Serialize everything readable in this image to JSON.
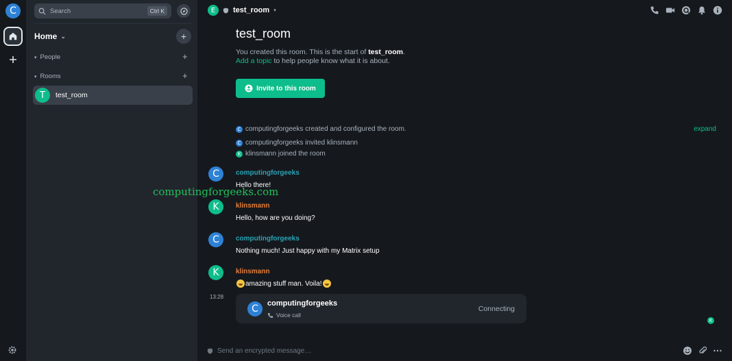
{
  "user": {
    "avatar_letter": "C"
  },
  "space_panel": {
    "home_icon": "home-icon",
    "add_space_icon": "plus-icon",
    "settings_icon": "gear-icon"
  },
  "search": {
    "placeholder": "Search",
    "shortcut": "Ctrl K"
  },
  "home": {
    "title": "Home"
  },
  "sections": {
    "people": {
      "label": "People"
    },
    "rooms": {
      "label": "Rooms"
    }
  },
  "rooms": [
    {
      "avatar_letter": "T",
      "name": "test_room"
    }
  ],
  "header": {
    "avatar_letter": "E",
    "title": "test_room"
  },
  "intro": {
    "title": "test_room",
    "line1_prefix": "You created this room. This is the start of ",
    "line1_room": "test_room",
    "line1_suffix": ".",
    "topic_link": "Add a topic",
    "line2_suffix": " to help people know what it is about.",
    "invite_label": "Invite to this room"
  },
  "events": [
    {
      "avatar_letter": "C",
      "color": "#2e82d6",
      "text": "computingforgeeks created and configured the room."
    },
    {
      "avatar_letter": "C",
      "color": "#2e82d6",
      "text": "computingforgeeks invited klinsmann"
    },
    {
      "avatar_letter": "K",
      "color": "#0dbd8b",
      "text": "klinsmann joined the room"
    }
  ],
  "expand_label": "expand",
  "messages": [
    {
      "avatar_letter": "C",
      "sender": "computingforgeeks",
      "sender_color": "#2aa3b5",
      "avatar_color": "#2e82d6",
      "text": "Hello there!"
    },
    {
      "avatar_letter": "K",
      "sender": "klinsmann",
      "sender_color": "#e57e39",
      "avatar_color": "#0dbd8b",
      "text": "Hello, how are you doing?"
    },
    {
      "avatar_letter": "C",
      "sender": "computingforgeeks",
      "sender_color": "#2aa3b5",
      "avatar_color": "#2e82d6",
      "text": "Nothing much! Just happy with my Matrix setup"
    },
    {
      "avatar_letter": "K",
      "sender": "klinsmann",
      "sender_color": "#e57e39",
      "avatar_color": "#0dbd8b",
      "text": "amazing stuff man. Voila!"
    }
  ],
  "call": {
    "timestamp": "13:28",
    "avatar_letter": "C",
    "name": "computingforgeeks",
    "type": "Voice call",
    "status": "Connecting"
  },
  "read_receipt_letter": "K",
  "composer": {
    "placeholder": "Send an encrypted message…"
  },
  "watermark": "computingforgeeks.com",
  "colors": {
    "accent": "#0dbd8b",
    "bg": "#15191e",
    "panel": "#21262c"
  }
}
